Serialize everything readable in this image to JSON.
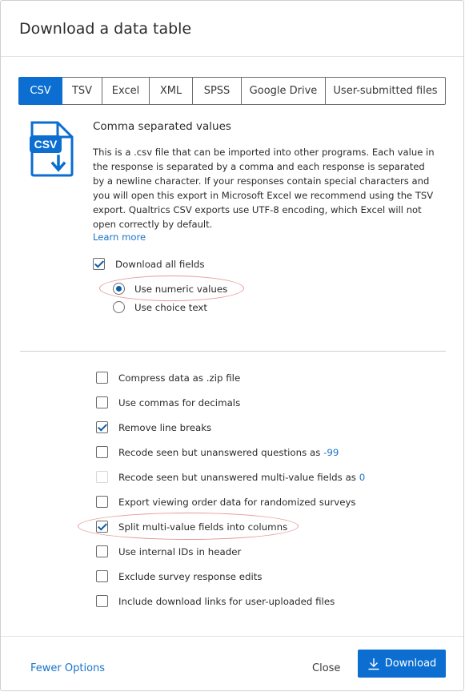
{
  "dialog": {
    "title": "Download a data table"
  },
  "tabs": [
    {
      "label": "CSV",
      "active": true
    },
    {
      "label": "TSV",
      "active": false
    },
    {
      "label": "Excel",
      "active": false
    },
    {
      "label": "XML",
      "active": false
    },
    {
      "label": "SPSS",
      "active": false
    },
    {
      "label": "Google Drive",
      "active": false
    },
    {
      "label": "User-submitted files",
      "active": false
    }
  ],
  "format": {
    "icon_text": "CSV",
    "title": "Comma separated values",
    "description": "This is a .csv file that can be imported into other programs. Each value in the response is separated by a comma and each response is separated by a newline character. If your responses contain special characters and you will open this export in Microsoft Excel we recommend using the TSV export. Qualtrics CSV exports use UTF-8 encoding, which Excel will not open correctly by default.",
    "learn_more": "Learn more"
  },
  "fields": {
    "download_all": {
      "label": "Download all fields",
      "checked": true
    },
    "value_mode": [
      {
        "label": "Use numeric values",
        "selected": true
      },
      {
        "label": "Use choice text",
        "selected": false
      }
    ]
  },
  "options": [
    {
      "label": "Compress data as .zip file",
      "checked": false
    },
    {
      "label": "Use commas for decimals",
      "checked": false
    },
    {
      "label": "Remove line breaks",
      "checked": true
    },
    {
      "label": "Recode seen but unanswered questions as",
      "value": "-99",
      "checked": false
    },
    {
      "label": "Recode seen but unanswered multi-value fields as",
      "value": "0",
      "checked": false,
      "disabled": true
    },
    {
      "label": "Export viewing order data for randomized surveys",
      "checked": false
    },
    {
      "label": "Split multi-value fields into columns",
      "checked": true
    },
    {
      "label": "Use internal IDs in header",
      "checked": false
    },
    {
      "label": "Exclude survey response edits",
      "checked": false
    },
    {
      "label": "Include download links for user-uploaded files",
      "checked": false
    }
  ],
  "footer": {
    "fewer_options": "Fewer Options",
    "close": "Close",
    "download": "Download"
  },
  "colors": {
    "accent": "#0b6ed0",
    "link": "#1a73c8",
    "highlight": "#e79a9a"
  }
}
